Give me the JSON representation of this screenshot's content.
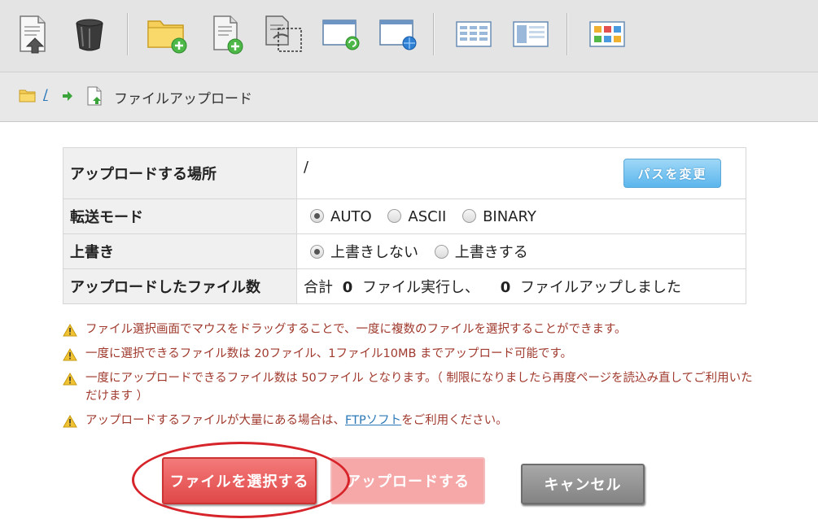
{
  "toolbar": {
    "items": [
      {
        "icon": "upload-file-icon"
      },
      {
        "icon": "trash-icon"
      },
      {
        "icon": "new-folder-icon"
      },
      {
        "icon": "new-file-icon"
      },
      {
        "icon": "copy-file-icon"
      },
      {
        "icon": "window-refresh-icon"
      },
      {
        "icon": "window-web-icon"
      },
      {
        "icon": "list-view-icon"
      },
      {
        "icon": "detail-view-icon"
      },
      {
        "icon": "tile-view-icon"
      }
    ]
  },
  "breadcrumb": {
    "root": "/",
    "current": "ファイルアップロード"
  },
  "form": {
    "location_label": "アップロードする場所",
    "location_value": "/",
    "change_path_label": "パスを変更",
    "mode_label": "転送モード",
    "mode_options": [
      "AUTO",
      "ASCII",
      "BINARY"
    ],
    "mode_selected": "AUTO",
    "overwrite_label": "上書き",
    "overwrite_options": [
      "上書きしない",
      "上書きする"
    ],
    "overwrite_selected": "上書きしない",
    "count_label": "アップロードしたファイル数",
    "count_prefix": "合計",
    "executed_count": "0",
    "count_mid": "ファイル実行し、",
    "uploaded_count": "0",
    "count_suffix": "ファイルアップしました"
  },
  "notes": {
    "n1": "ファイル選択画面でマウスをドラッグすることで、一度に複数のファイルを選択することができます。",
    "n2": "一度に選択できるファイル数は 20ファイル、1ファイル10MB までアップロード可能です。",
    "n3": "一度にアップロードできるファイル数は 50ファイル となります。（ 制限になりましたら再度ページを読込み直してご利用いただけます ）",
    "n4_before": "アップロードするファイルが大量にある場合は、",
    "n4_link": "FTPソフト",
    "n4_after": "をご利用ください。"
  },
  "buttons": {
    "select": "ファイルを選択する",
    "upload": "アップロードする",
    "cancel": "キャンセル"
  },
  "colors": {
    "accent_blue": "#5bb6ec",
    "select_red": "#e04848",
    "annotation_red": "#d6242a",
    "note_text": "#a03a2e"
  }
}
